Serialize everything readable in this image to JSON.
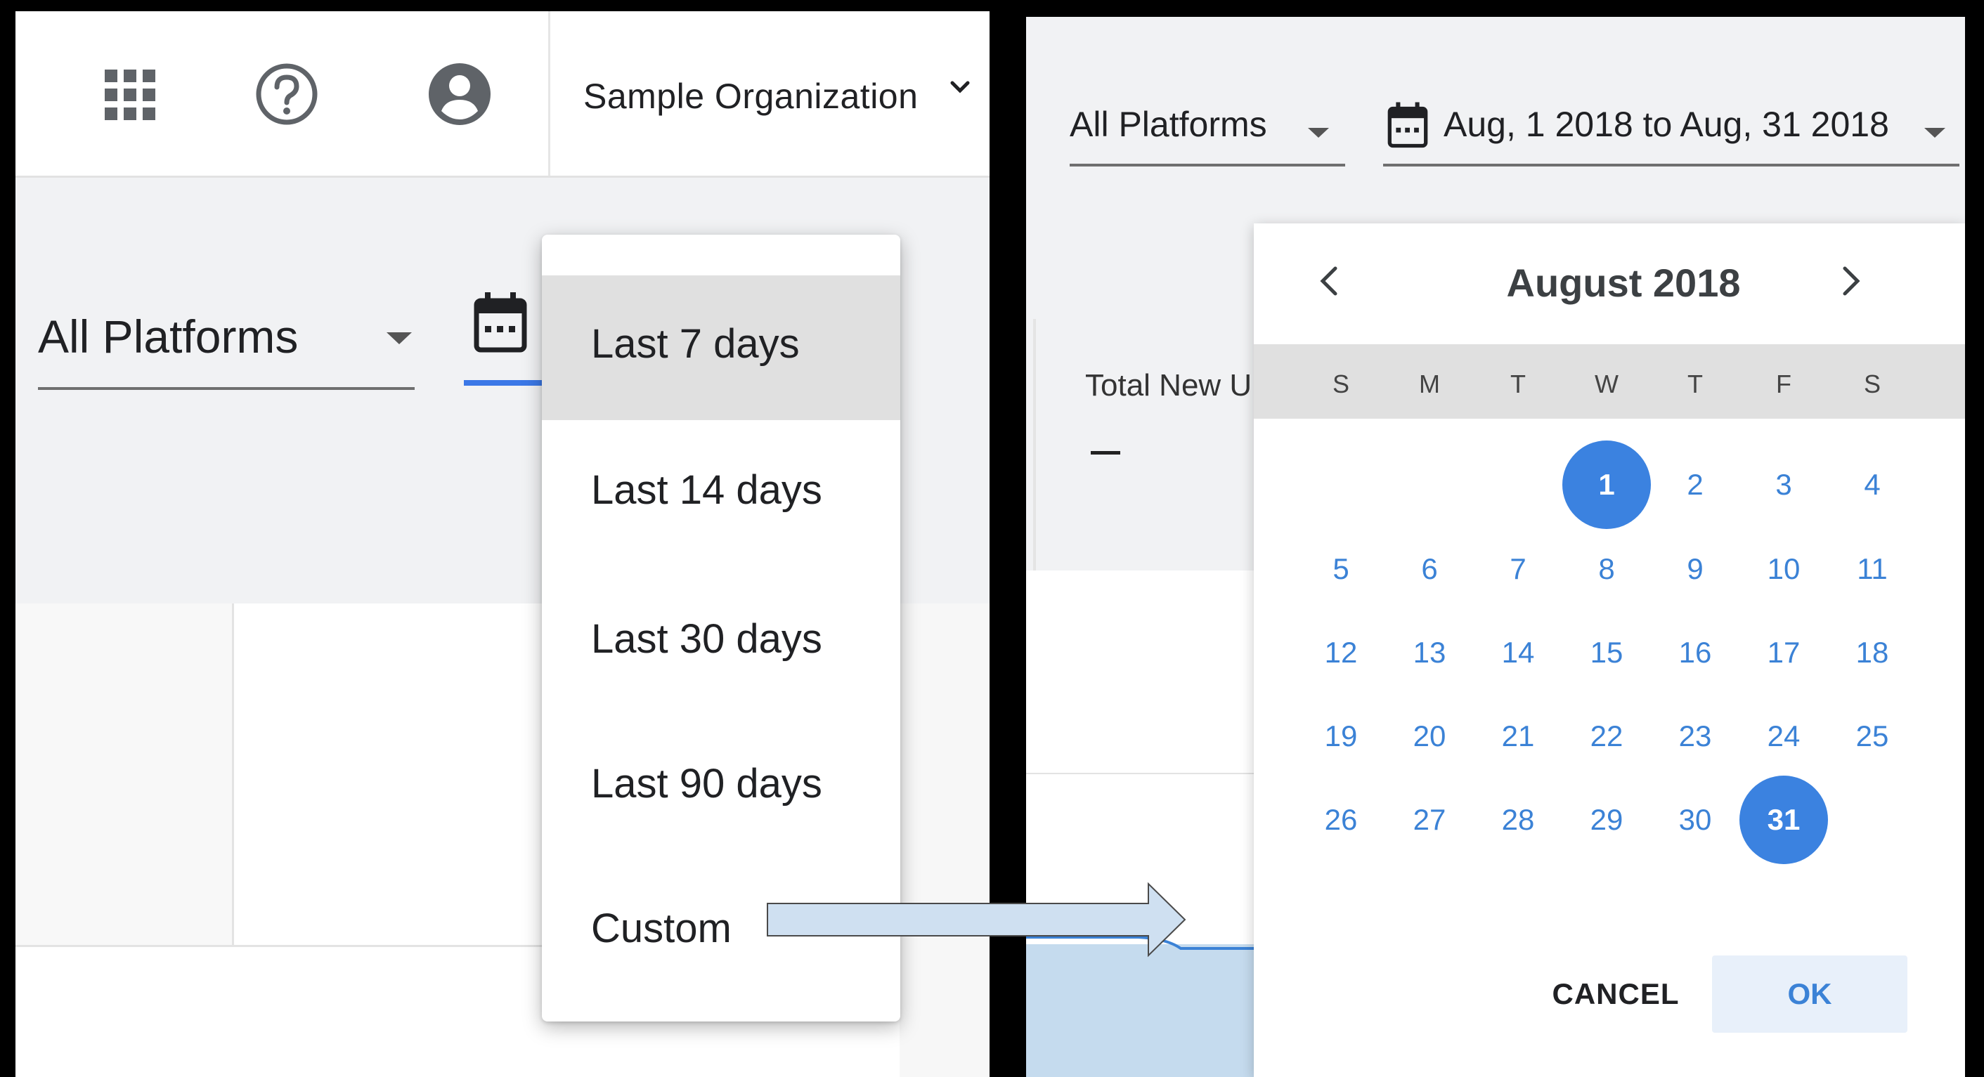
{
  "left": {
    "org_name": "Sample Organization",
    "platform_label": "All Platforms",
    "date_menu": [
      {
        "label": "Last 7 days",
        "selected": true
      },
      {
        "label": "Last 14 days",
        "selected": false
      },
      {
        "label": "Last 30 days",
        "selected": false
      },
      {
        "label": "Last 90 days",
        "selected": false
      },
      {
        "label": "Custom",
        "selected": false
      }
    ],
    "icons": [
      "apps-grid-icon",
      "help-icon",
      "account-icon",
      "chevron-down-icon",
      "calendar-icon"
    ]
  },
  "right": {
    "platform_label": "All Platforms",
    "date_range_label": "Aug, 1 2018 to Aug, 31 2018",
    "card_title": "Total New U",
    "calendar": {
      "title": "August 2018",
      "weekdays": [
        "S",
        "M",
        "T",
        "W",
        "T",
        "F",
        "S"
      ],
      "first_weekday_index": 3,
      "days_in_month": 31,
      "selected_days": [
        1,
        31
      ],
      "cancel_label": "CANCEL",
      "ok_label": "OK"
    }
  },
  "colors": {
    "accent": "#3b82e0",
    "selected_menu_bg": "#e0e0e0",
    "arrow_fill": "#cfe0f1",
    "arrow_stroke": "#4a4a4a"
  }
}
